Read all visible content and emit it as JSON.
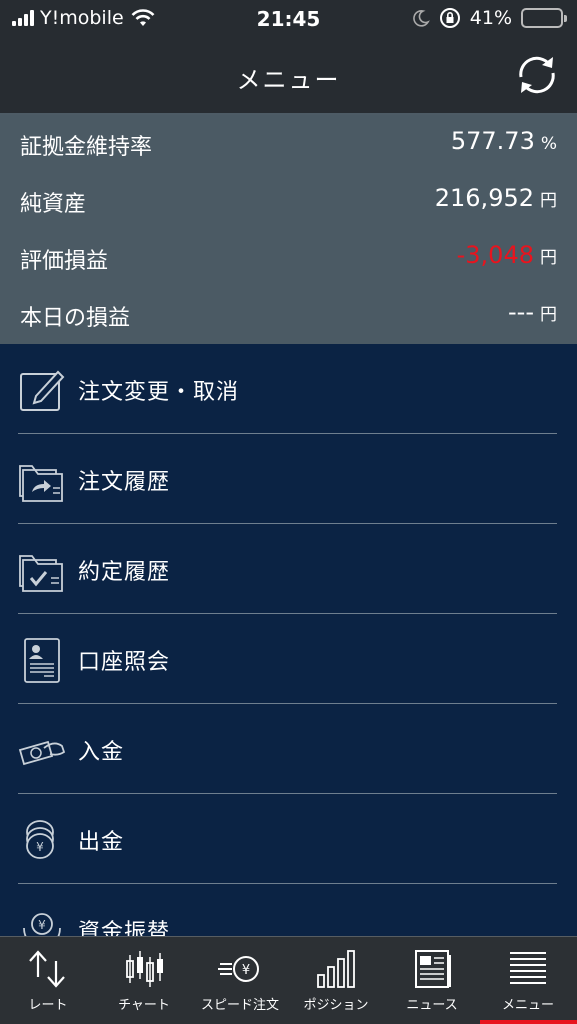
{
  "status_bar": {
    "carrier": "Y!mobile",
    "time": "21:45",
    "battery": "41%"
  },
  "header": {
    "title": "メニュー",
    "refresh_icon": "refresh-icon"
  },
  "account": {
    "rows": [
      {
        "label": "証拠金維持率",
        "value": "577.73",
        "unit": "%"
      },
      {
        "label": "純資産",
        "value": "216,952",
        "unit": "円"
      },
      {
        "label": "評価損益",
        "value": "-3,048",
        "unit": "円",
        "color": "#e8141e"
      },
      {
        "label": "本日の損益",
        "value": "---",
        "unit": "円"
      }
    ]
  },
  "menu": {
    "items": [
      {
        "label": "注文変更・取消",
        "icon": "edit-icon"
      },
      {
        "label": "注文履歴",
        "icon": "order-history-folder-icon"
      },
      {
        "label": "約定履歴",
        "icon": "execution-history-folder-icon"
      },
      {
        "label": "口座照会",
        "icon": "account-document-icon"
      },
      {
        "label": "入金",
        "icon": "deposit-hand-icon"
      },
      {
        "label": "出金",
        "icon": "withdraw-coins-icon"
      },
      {
        "label": "資金振替",
        "icon": "transfer-icon"
      }
    ]
  },
  "tab_bar": {
    "tabs": [
      {
        "label": "レート",
        "icon": "rate-arrows-icon"
      },
      {
        "label": "チャート",
        "icon": "candlestick-icon"
      },
      {
        "label": "スピード注文",
        "icon": "speed-order-icon"
      },
      {
        "label": "ポジション",
        "icon": "position-bars-icon"
      },
      {
        "label": "ニュース",
        "icon": "newspaper-icon"
      },
      {
        "label": "メニュー",
        "icon": "menu-lines-icon"
      }
    ],
    "active": "メニュー",
    "active_color": "#e8141e"
  },
  "colors": {
    "header_bg": "#272c31",
    "account_bg": "#4b5a64",
    "menu_bg": "#0b2344",
    "negative": "#e8141e"
  }
}
